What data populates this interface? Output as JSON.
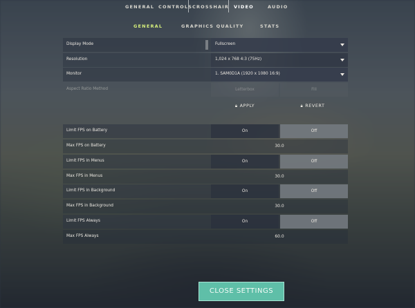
{
  "top_nav": [
    {
      "label": "GENERAL"
    },
    {
      "label": "CONTROLS"
    },
    {
      "label": "CROSSHAIR"
    },
    {
      "label": "VIDEO"
    },
    {
      "label": "AUDIO"
    }
  ],
  "sub_nav": [
    {
      "label": "GENERAL"
    },
    {
      "label": "GRAPHICS QUALITY"
    },
    {
      "label": "STATS"
    }
  ],
  "display_mode": {
    "label": "Display Mode",
    "value": "Fullscreen"
  },
  "resolution": {
    "label": "Resolution",
    "value": "1,024 x 768 4:3 (75Hz)"
  },
  "monitor": {
    "label": "Monitor",
    "value": "1. SAM0D1A (1920 x 1080 16:9)"
  },
  "aspect_ratio": {
    "label": "Aspect Ratio Method",
    "option_a": "Letterbox",
    "option_b": "Fill"
  },
  "apply_label": "APPLY",
  "revert_label": "REVERT",
  "fps_settings": [
    {
      "label": "Limit FPS on Battery",
      "on": "On",
      "off": "Off"
    },
    {
      "label": "Max FPS on Battery",
      "value": "30.0"
    },
    {
      "label": "Limit FPS in Menus",
      "on": "On",
      "off": "Off"
    },
    {
      "label": "Max FPS in Menus",
      "value": "30.0"
    },
    {
      "label": "Limit FPS in Background",
      "on": "On",
      "off": "Off"
    },
    {
      "label": "Max FPS in Background",
      "value": "30.0"
    },
    {
      "label": "Limit FPS Always",
      "on": "On",
      "off": "Off"
    },
    {
      "label": "Max FPS Always",
      "value": "60.0"
    }
  ],
  "close_label": "CLOSE SETTINGS",
  "colors": {
    "active_subtab": "#d6f07c",
    "close_button": "#5fbfa8"
  }
}
